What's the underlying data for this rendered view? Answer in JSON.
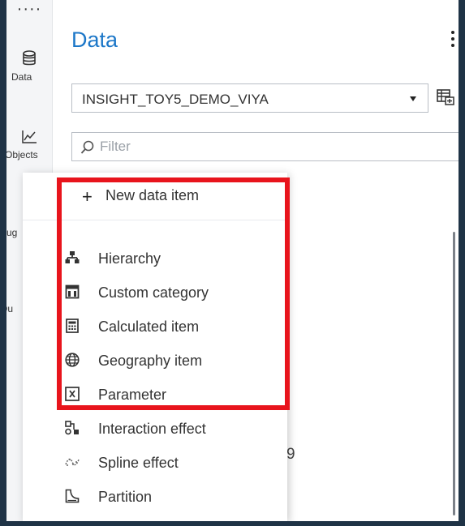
{
  "rail": {
    "items": [
      {
        "label": "Data",
        "icon": "database-icon"
      },
      {
        "label": "Objects",
        "icon": "line-chart-icon"
      },
      {
        "label": "Sug",
        "icon": "lightbulb-icon"
      },
      {
        "label": "Ou",
        "icon": "vertical-ellipsis-icon"
      }
    ]
  },
  "panel": {
    "title": "Data",
    "data_source": "INSIGHT_TOY5_DEMO_VIYA",
    "filter_placeholder": "Filter",
    "background_fragment": "9"
  },
  "menu": {
    "header_label": "New data item",
    "items": [
      {
        "label": "Hierarchy",
        "icon": "hierarchy-icon"
      },
      {
        "label": "Custom category",
        "icon": "custom-category-icon"
      },
      {
        "label": "Calculated item",
        "icon": "calculator-icon"
      },
      {
        "label": "Geography item",
        "icon": "globe-icon"
      },
      {
        "label": "Parameter",
        "icon": "parameter-x-icon"
      },
      {
        "label": "Interaction effect",
        "icon": "interaction-effect-icon"
      },
      {
        "label": "Spline effect",
        "icon": "spline-effect-icon"
      },
      {
        "label": "Partition",
        "icon": "partition-icon"
      }
    ]
  },
  "colors": {
    "accent": "#1c77c8",
    "highlight": "#e8141c"
  }
}
